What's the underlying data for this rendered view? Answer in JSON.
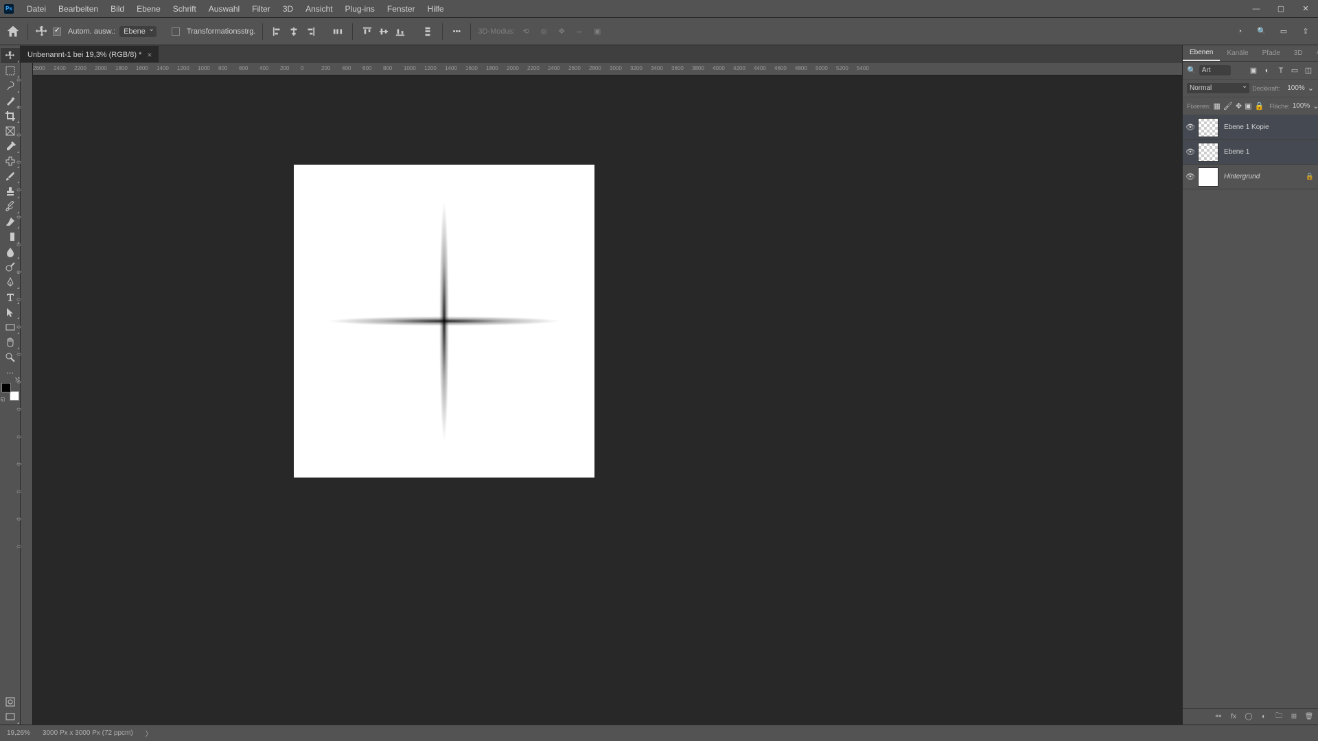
{
  "menubar": [
    "Datei",
    "Bearbeiten",
    "Bild",
    "Ebene",
    "Schrift",
    "Auswahl",
    "Filter",
    "3D",
    "Ansicht",
    "Plug-ins",
    "Fenster",
    "Hilfe"
  ],
  "optionsbar": {
    "auto_select": "Autom. ausw.:",
    "target": "Ebene",
    "transform": "Transformationsstrg.",
    "mode3d": "3D-Modus:"
  },
  "document": {
    "tab": "Unbenannt-1 bei 19,3% (RGB/8) *"
  },
  "ruler_h": [
    "2600",
    "2400",
    "2200",
    "2000",
    "1800",
    "1600",
    "1400",
    "1200",
    "1000",
    "800",
    "600",
    "400",
    "200",
    "0",
    "200",
    "400",
    "600",
    "800",
    "1000",
    "1200",
    "1400",
    "1600",
    "1800",
    "2000",
    "2200",
    "2400",
    "2600",
    "2800",
    "3000",
    "3200",
    "3400",
    "3600",
    "3800",
    "4000",
    "4200",
    "4400",
    "4600",
    "4800",
    "5000",
    "5200",
    "5400"
  ],
  "ruler_v": [
    "0",
    "0",
    "0",
    "0",
    "0",
    "0",
    "0",
    "0",
    "0",
    "0",
    "0",
    "0",
    "0",
    "0",
    "0",
    "0",
    "0",
    "0"
  ],
  "panel": {
    "tabs": [
      "Ebenen",
      "Kanäle",
      "Pfade",
      "3D"
    ],
    "search": "Art",
    "blend": "Normal",
    "opacity_label": "Deckkraft:",
    "opacity": "100%",
    "lock_label": "Fixieren:",
    "fill_label": "Fläche:",
    "fill": "100%",
    "layers": [
      {
        "name": "Ebene 1 Kopie",
        "trans": true,
        "sel": true,
        "lock": false,
        "visible": true
      },
      {
        "name": "Ebene 1",
        "trans": true,
        "sel": true,
        "lock": false,
        "visible": true
      },
      {
        "name": "Hintergrund",
        "trans": false,
        "sel": false,
        "lock": true,
        "visible": true,
        "italic": true
      }
    ]
  },
  "status": {
    "zoom": "19,26%",
    "dims": "3000 Px x 3000 Px (72 ppcm)",
    "caret": "〉"
  }
}
